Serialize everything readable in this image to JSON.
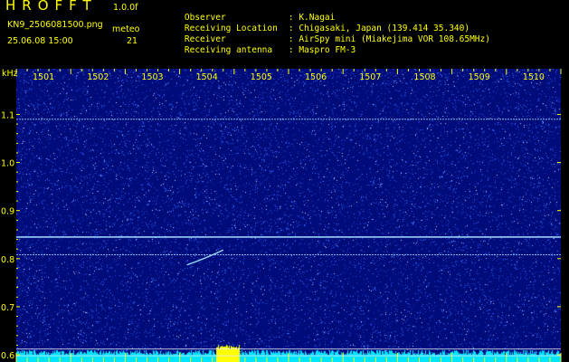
{
  "header": {
    "app_title": "HROFFT",
    "version": "1.0.0f",
    "file_name": "KN9_2506081500.png",
    "timestamp": "25.06.08 15:00",
    "meteo_label": "meteo",
    "meteo_count": "21"
  },
  "metadata": [
    {
      "label": "Observer",
      "value": ": K.Nagai"
    },
    {
      "label": "Receiving Location",
      "value": ": Chigasaki, Japan (139.414 35.340)"
    },
    {
      "label": "Receiver",
      "value": ": AirSpy mini (Miakejima VOR 108.65MHz)"
    },
    {
      "label": "Receiving antenna",
      "value": ": Maspro FM-3"
    }
  ],
  "spectrogram": {
    "y_unit": "kHz",
    "y_ticks": [
      "1.1",
      "1.0",
      "0.9",
      "0.8",
      "0.7",
      "0.6"
    ],
    "y_tick_values": [
      1.1,
      1.0,
      0.9,
      0.8,
      0.7,
      0.6
    ],
    "y_range": [
      0.585,
      1.195
    ],
    "time_ticks": [
      "1501",
      "1502",
      "1503",
      "1504",
      "1505",
      "1506",
      "1507",
      "1508",
      "1509",
      "1510"
    ],
    "carrier_lines_khz": [
      1.09,
      0.845,
      0.808,
      0.612,
      0.598
    ],
    "colors": {
      "text": "#ffff00",
      "background": "#000c7a",
      "noise_dot": "#3a6cff",
      "carrier": "#9fdcff",
      "signal_floor": "#00e5ff"
    }
  }
}
